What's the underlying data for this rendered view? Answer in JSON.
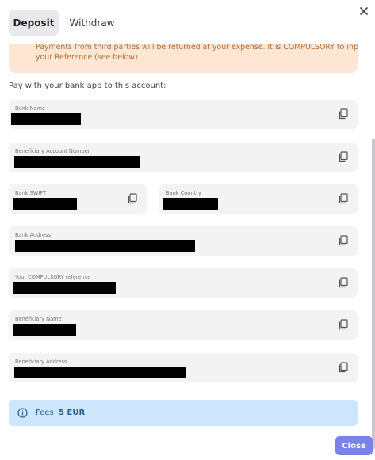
{
  "tabs": [
    {
      "label": "Deposit",
      "active": true
    },
    {
      "label": "Withdraw",
      "active": false
    }
  ],
  "warning": {
    "line1": "Payments from third parties will be returned at your expense. It is COMPULSORY to input",
    "line2": "your Reference (see below)"
  },
  "intro": "Pay with your bank app to this account:",
  "fields": {
    "bank_name": {
      "label": "Bank Name",
      "value": ""
    },
    "beneficiary_account_number": {
      "label": "Beneficiary Account Number",
      "value": ""
    },
    "bank_swift": {
      "label": "Bank SWIFT",
      "value": ""
    },
    "bank_country": {
      "label": "Bank Country",
      "value": ""
    },
    "bank_address": {
      "label": "Bank Address",
      "value": ""
    },
    "reference": {
      "label": "Your COMPULSORY reference",
      "value": ""
    },
    "beneficiary_name": {
      "label": "Beneficiary Name",
      "value": ""
    },
    "beneficiary_address": {
      "label": "Beneficiary Address",
      "value": ""
    }
  },
  "fees": {
    "label": "Fees:",
    "value": "5 EUR"
  },
  "close_button": "Close",
  "icons": {
    "close": "close-icon",
    "copy": "copy-icon",
    "info": "info-icon"
  },
  "colors": {
    "accent": "#7b83eb",
    "warning_bg": "#fde6d3",
    "info_bg": "#cde6fb"
  }
}
